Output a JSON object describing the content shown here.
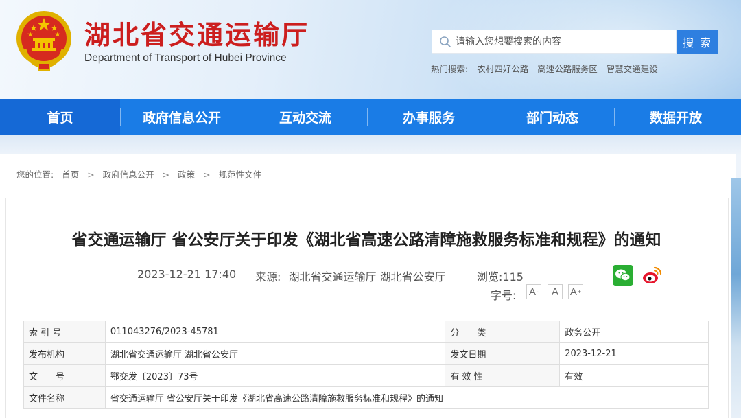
{
  "header": {
    "site_title": "湖北省交通运输厅",
    "site_subtitle": "Department of Transport of Hubei Province",
    "emblem": "national-emblem-icon"
  },
  "search": {
    "placeholder": "请输入您想要搜索的内容",
    "button": "搜 索",
    "hot_label": "热门搜索:",
    "hot_links": [
      "农村四好公路",
      "高速公路服务区",
      "智慧交通建设"
    ]
  },
  "nav": {
    "items": [
      "首页",
      "政府信息公开",
      "互动交流",
      "办事服务",
      "部门动态",
      "数据开放"
    ],
    "active_index": 0
  },
  "breadcrumb": {
    "label": "您的位置:",
    "items": [
      "首页",
      "政府信息公开",
      "政策",
      "规范性文件"
    ],
    "separator": ">"
  },
  "article": {
    "title": "省交通运输厅 省公安厅关于印发《湖北省高速公路清障施救服务标准和规程》的通知",
    "datetime": "2023-12-21 17:40",
    "source_label": "来源:",
    "source": "湖北省交通运输厅 湖北省公安厅",
    "views_label": "浏览:",
    "views": "115",
    "fontsize_label": "字号:",
    "fontsize_buttons": [
      "A",
      "A",
      "A"
    ],
    "fontsize_marks": [
      "-",
      "",
      "+"
    ],
    "share": [
      "wechat-icon",
      "weibo-icon"
    ]
  },
  "info_table": {
    "rows": [
      [
        "索 引 号",
        "011043276/2023-45781",
        "分　　类",
        "政务公开"
      ],
      [
        "发布机构",
        "湖北省交通运输厅 湖北省公安厅",
        "发文日期",
        "2023-12-21"
      ],
      [
        "文　　号",
        "鄂交发〔2023〕73号",
        "有 效 性",
        "有效"
      ]
    ],
    "name_row": [
      "文件名称",
      "省交通运输厅 省公安厅关于印发《湖北省高速公路清障施救服务标准和规程》的通知"
    ]
  },
  "colors": {
    "brand_red": "#cc1e1e",
    "nav_blue": "#1a7ce6",
    "search_blue": "#2e7fe0"
  }
}
